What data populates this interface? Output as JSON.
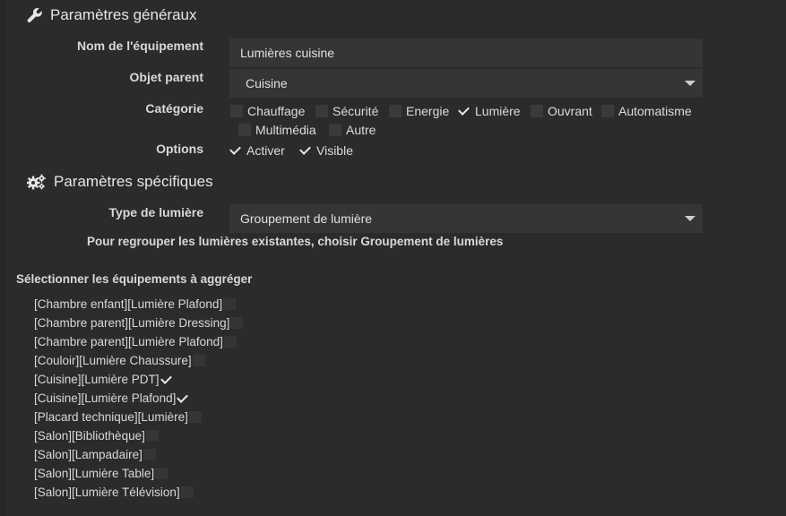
{
  "general": {
    "title": "Paramètres généraux",
    "name_label": "Nom de l'équipement",
    "name_value": "Lumières cuisine",
    "parent_label": "Objet parent",
    "parent_value": "Cuisine",
    "category_label": "Catégorie",
    "categories": [
      {
        "label": "Chauffage",
        "checked": false
      },
      {
        "label": "Sécurité",
        "checked": false
      },
      {
        "label": "Energie",
        "checked": false
      },
      {
        "label": "Lumière",
        "checked": true
      },
      {
        "label": "Ouvrant",
        "checked": false
      },
      {
        "label": "Automatisme",
        "checked": false
      },
      {
        "label": "Multimédia",
        "checked": false
      },
      {
        "label": "Autre",
        "checked": false
      }
    ],
    "options_label": "Options",
    "options": [
      {
        "label": "Activer",
        "checked": true
      },
      {
        "label": "Visible",
        "checked": true
      }
    ]
  },
  "specific": {
    "title": "Paramètres spécifiques",
    "type_label": "Type de lumière",
    "type_value": "Groupement de lumière",
    "hint": "Pour regrouper les lumières existantes, choisir Groupement de lumières"
  },
  "aggregate": {
    "title": "Sélectionner les équipements à aggréger",
    "items": [
      {
        "label": "[Chambre enfant][Lumière Plafond]",
        "checked": false
      },
      {
        "label": "[Chambre parent][Lumière Dressing]",
        "checked": false
      },
      {
        "label": "[Chambre parent][Lumière Plafond]",
        "checked": false
      },
      {
        "label": "[Couloir][Lumière Chaussure]",
        "checked": false
      },
      {
        "label": "[Cuisine][Lumière PDT]",
        "checked": true
      },
      {
        "label": "[Cuisine][Lumière Plafond]",
        "checked": true
      },
      {
        "label": "[Placard technique][Lumière]",
        "checked": false
      },
      {
        "label": "[Salon][Bibliothèque]",
        "checked": false
      },
      {
        "label": "[Salon][Lampadaire]",
        "checked": false
      },
      {
        "label": "[Salon][Lumière Table]",
        "checked": false
      },
      {
        "label": "[Salon][Lumière Télévision]",
        "checked": false
      }
    ]
  }
}
